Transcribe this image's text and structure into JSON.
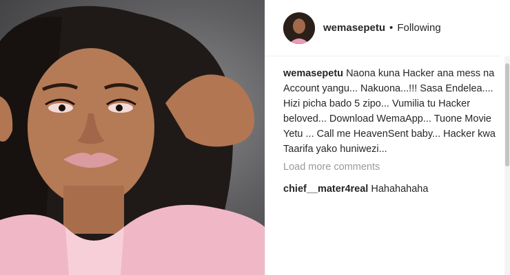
{
  "header": {
    "username": "wemasepetu",
    "separator": "•",
    "follow_status": "Following"
  },
  "caption": {
    "username": "wemasepetu",
    "text": "Naona kuna Hacker ana mess na Account yangu... Nakuona...!!! Sasa Endelea.... Hizi picha bado 5 zipo... Vumilia tu Hacker beloved... Download WemaApp... Tuone Movie Yetu ... Call me HeavenSent baby... Hacker kwa Taarifa yako huniwezi..."
  },
  "load_more": "Load more comments",
  "comments": [
    {
      "username": "chief__mater4real",
      "text": "Hahahahaha"
    }
  ],
  "icons": {
    "avatar": "profile-photo",
    "photo": "post-photo"
  },
  "colors": {
    "background": "#ffffff",
    "text": "#262626",
    "muted": "#999999",
    "divider": "#efefef"
  }
}
